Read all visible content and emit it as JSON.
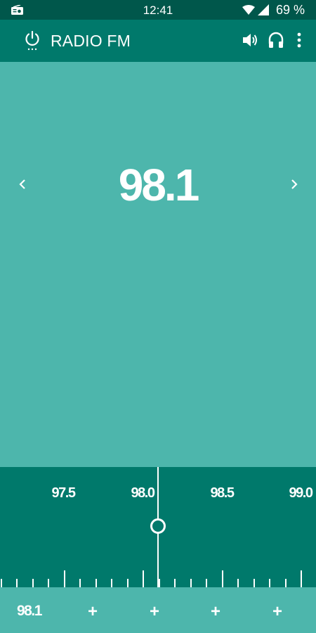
{
  "status_bar": {
    "time": "12:41",
    "battery": "69 %",
    "icons": [
      "radio-icon",
      "wifi-icon",
      "signal-icon"
    ]
  },
  "toolbar": {
    "title": "RADIO FM",
    "icons": [
      "power-icon",
      "volume-icon",
      "headphones-icon",
      "more-vert-icon"
    ]
  },
  "main": {
    "frequency": "98.1",
    "prev_icon": "chevron-left-icon",
    "next_icon": "chevron-right-icon"
  },
  "dial": {
    "labels": [
      "97.5",
      "98.0",
      "98.5",
      "99.0"
    ],
    "current_value": 98.1
  },
  "presets": {
    "items": [
      "98.1",
      "+",
      "+",
      "+",
      "+"
    ]
  },
  "colors": {
    "status_bar": "#00574b",
    "toolbar": "#00796b",
    "main_background": "#4db6ac",
    "dial_background": "#00796b",
    "foreground": "#ffffff"
  }
}
